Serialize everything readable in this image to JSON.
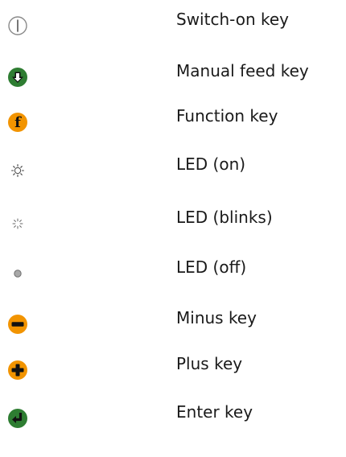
{
  "legend": {
    "items": [
      {
        "label": "Switch-on key",
        "icon": "power-key-icon"
      },
      {
        "label": "Manual feed key",
        "icon": "manual-feed-arrow-icon"
      },
      {
        "label": "Function key",
        "icon": "function-f-icon"
      },
      {
        "label": "LED (on)",
        "icon": "led-on-icon"
      },
      {
        "label": "LED (blinks)",
        "icon": "led-blink-icon"
      },
      {
        "label": "LED (off)",
        "icon": "led-off-icon"
      },
      {
        "label": "Minus key",
        "icon": "minus-key-icon"
      },
      {
        "label": "Plus key",
        "icon": "plus-key-icon"
      },
      {
        "label": "Enter key",
        "icon": "enter-key-icon"
      }
    ]
  },
  "colors": {
    "green_key": "#2e7d32",
    "orange_key": "#f29400",
    "led_off": "#9e9e9e",
    "outline": "#7a7a7a"
  }
}
